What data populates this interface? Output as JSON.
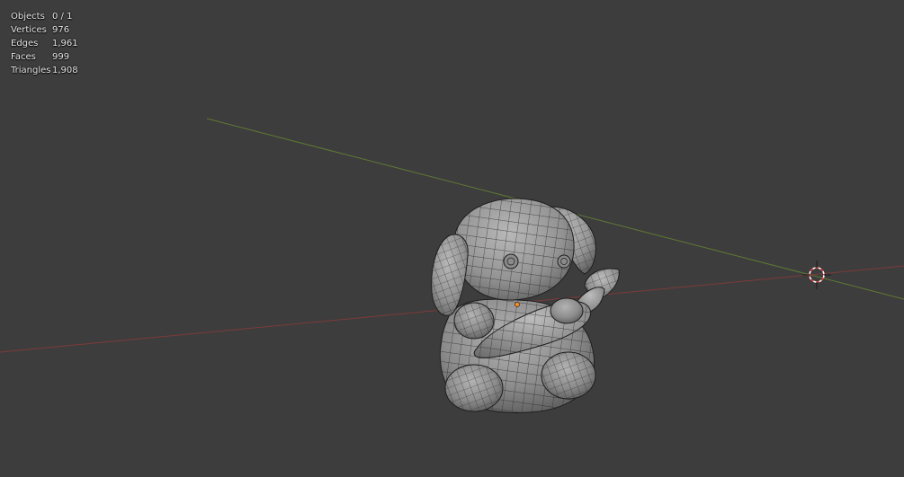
{
  "viewport": {
    "background_color": "#3d3d3d",
    "x_axis_color": "#8a3b3b",
    "y_axis_color": "#6b8a3a",
    "object": "bunny-with-carrot-wireframe-mesh"
  },
  "stats": {
    "objects_label": "Objects",
    "objects_value": "0 / 1",
    "vertices_label": "Vertices",
    "vertices_value": "976",
    "edges_label": "Edges",
    "edges_value": "1,961",
    "faces_label": "Faces",
    "faces_value": "999",
    "triangles_label": "Triangles",
    "triangles_value": "1,908"
  }
}
